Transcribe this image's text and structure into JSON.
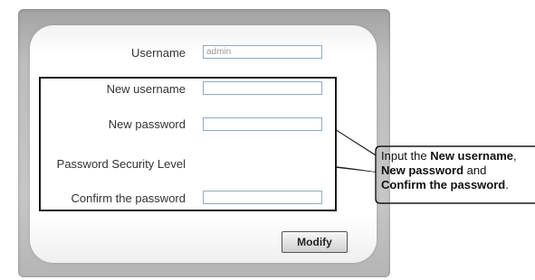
{
  "form": {
    "username_label": "Username",
    "username_value": "admin",
    "new_username_label": "New username",
    "new_username_value": "",
    "new_password_label": "New password",
    "new_password_value": "",
    "security_level_label": "Password Security Level",
    "confirm_password_label": "Confirm the password",
    "confirm_password_value": "",
    "modify_label": "Modify"
  },
  "callout": {
    "text_1": "Input the ",
    "bold_1": "New username",
    "text_2": ",",
    "bold_2": "New password",
    "text_3": " and",
    "bold_3": "Confirm the password",
    "text_4": "."
  }
}
